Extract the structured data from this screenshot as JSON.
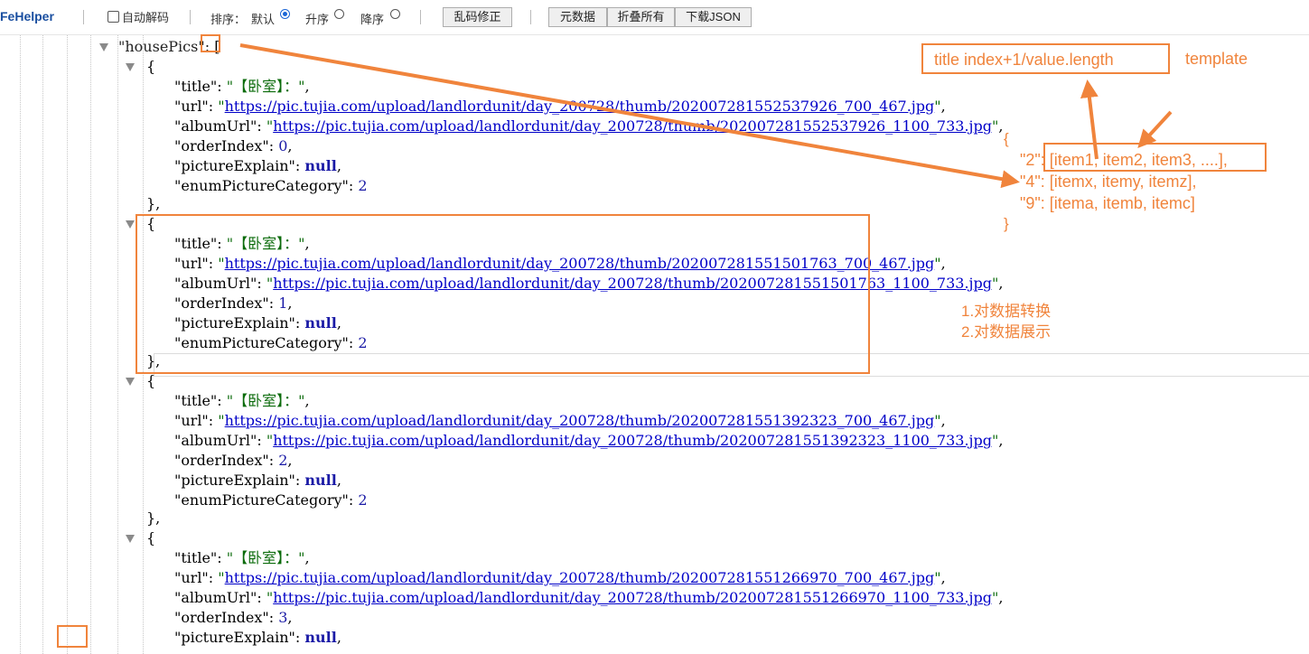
{
  "toolbar": {
    "brand": "FeHelper",
    "auto_decode_label": "自动解码",
    "sort_label": "排序：",
    "sort_default_label": "默认",
    "sort_asc_label": "升序",
    "sort_desc_label": "降序",
    "sort_selected": "默认",
    "fix_encoding_button": "乱码修正",
    "meta_button": "元数据",
    "collapse_all_button": "折叠所有",
    "download_button": "下载JSON"
  },
  "json": {
    "root_key": "housePics",
    "open_bracket": "[",
    "items": [
      {
        "title": "【卧室】：",
        "url": "https://pic.tujia.com/upload/landlordunit/day_200728/thumb/202007281552537926_700_467.jpg",
        "albumUrl": "https://pic.tujia.com/upload/landlordunit/day_200728/thumb/202007281552537926_1100_733.jpg",
        "orderIndex": "0",
        "pictureExplain": "null",
        "enumPictureCategory": "2"
      },
      {
        "title": "【卧室】：",
        "url": "https://pic.tujia.com/upload/landlordunit/day_200728/thumb/202007281551501763_700_467.jpg",
        "albumUrl": "https://pic.tujia.com/upload/landlordunit/day_200728/thumb/202007281551501763_1100_733.jpg",
        "orderIndex": "1",
        "pictureExplain": "null",
        "enumPictureCategory": "2"
      },
      {
        "title": "【卧室】：",
        "url": "https://pic.tujia.com/upload/landlordunit/day_200728/thumb/202007281551392323_700_467.jpg",
        "albumUrl": "https://pic.tujia.com/upload/landlordunit/day_200728/thumb/202007281551392323_1100_733.jpg",
        "orderIndex": "2",
        "pictureExplain": "null",
        "enumPictureCategory": "2"
      },
      {
        "title": "【卧室】：",
        "url": "https://pic.tujia.com/upload/landlordunit/day_200728/thumb/202007281551266970_700_467.jpg",
        "albumUrl": "https://pic.tujia.com/upload/landlordunit/day_200728/thumb/202007281551266970_1100_733.jpg",
        "orderIndex": "3",
        "pictureExplain": "null"
      }
    ]
  },
  "annotations": {
    "template_box": "title index+1/value.length",
    "template_label": "template",
    "obj_open": "{",
    "obj_close": "}",
    "map_lines": [
      "\"2\": [item1, item2, item3, ....],",
      "\"4\": [itemx, itemy, itemz],",
      "\"9\": [itema, itemb, itemc]"
    ],
    "steps": [
      "1.对数据转换",
      "2.对数据展示"
    ],
    "color": "#f0843c"
  }
}
